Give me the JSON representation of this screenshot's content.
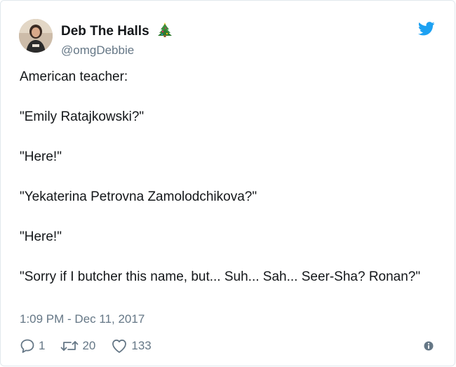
{
  "author": {
    "display_name": "Deb The Halls",
    "emoji": "christmas-tree-icon",
    "handle": "@omgDebbie"
  },
  "tweet": {
    "lines": [
      "American teacher:",
      "\"Emily Ratajkowski?\"",
      "\"Here!\"",
      "\"Yekaterina Petrovna Zamolodchikova?\"",
      "\"Here!\"",
      "\"Sorry if I butcher this name, but... Suh... Sah... Seer-Sha? Ronan?\""
    ],
    "timestamp": "1:09 PM - Dec 11, 2017"
  },
  "actions": {
    "reply_count": "1",
    "retweet_count": "20",
    "like_count": "133"
  },
  "colors": {
    "twitter_blue": "#1da1f2",
    "text": "#14171a",
    "secondary": "#657786",
    "border": "#e1e8ed"
  },
  "icons": [
    "twitter-bird-icon",
    "reply-icon",
    "retweet-icon",
    "heart-icon",
    "info-icon"
  ]
}
